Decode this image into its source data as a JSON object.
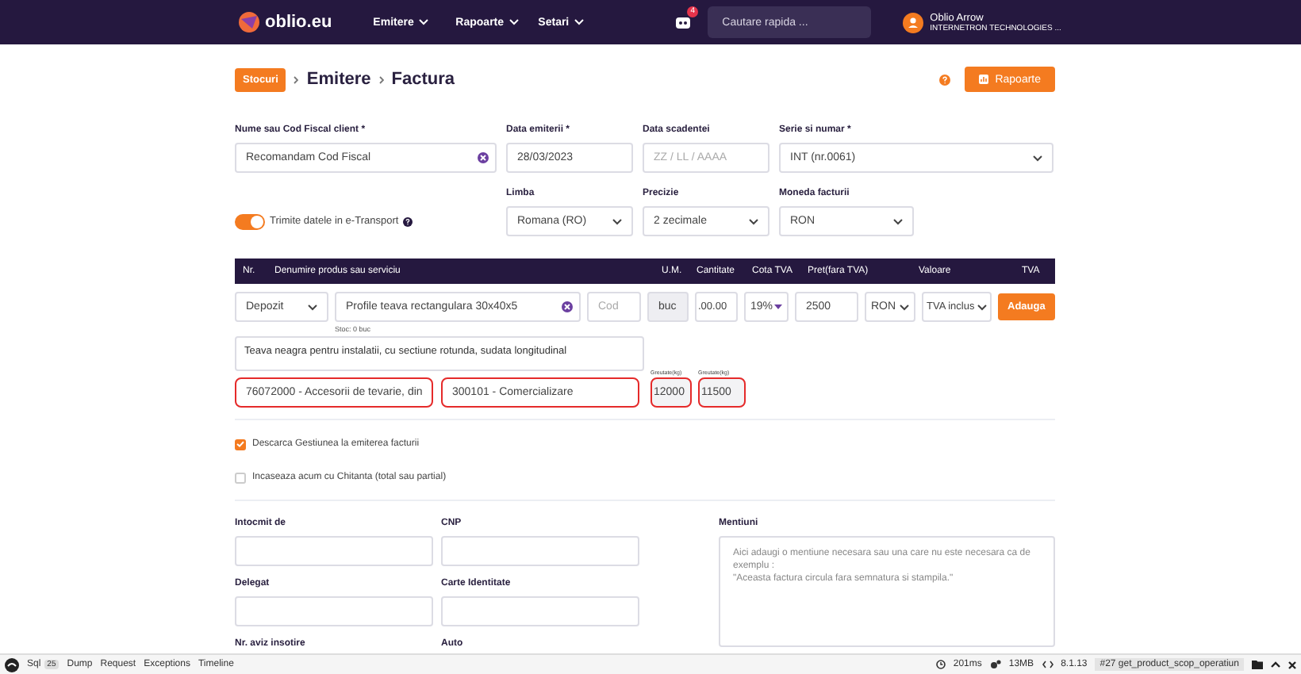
{
  "topbar": {
    "logo": "oblio.eu",
    "menu": [
      {
        "label": "Emitere"
      },
      {
        "label": "Rapoarte"
      },
      {
        "label": "Setari"
      }
    ],
    "notification_count": "4",
    "search": {
      "placeholder": "Cautare rapida ..."
    },
    "user": {
      "name": "Oblio Arrow",
      "company": "INTERNETRON TECHNOLOGIES ..."
    }
  },
  "breadcrumb": {
    "badge": "Stocuri",
    "items": [
      "Emitere",
      "Factura"
    ],
    "reports_button": "Rapoarte"
  },
  "header_fields": [
    {
      "label": "Nume sau Cod Fiscal client *",
      "kind": "clearable",
      "value": "Recomandam Cod Fiscal"
    },
    {
      "label": "Data emiterii *",
      "kind": "text",
      "value": "28/03/2023"
    },
    {
      "label": "Data scadentei",
      "kind": "text",
      "placeholder": "ZZ / LL / AAAA"
    },
    {
      "label": "Serie si numar *",
      "kind": "select",
      "value": "INT (nr.0061)"
    }
  ],
  "etransport": {
    "label": "Trimite datele in e-Transport",
    "on": true
  },
  "settings_fields": [
    {
      "label": "Limba",
      "kind": "select",
      "value": "Romana (RO)"
    },
    {
      "label": "Precizie",
      "kind": "select",
      "value": "2 zecimale"
    },
    {
      "label": "Moneda facturii",
      "kind": "select",
      "value": "RON"
    }
  ],
  "table": {
    "columns": [
      "Nr.",
      "Denumire produs sau serviciu",
      "U.M.",
      "Cantitate",
      "Cota TVA",
      "Pret(fara TVA)",
      "Valoare",
      "TVA"
    ]
  },
  "item_row": {
    "warehouse": "Depozit",
    "product_value": "Profile teava rectangulara 30x40x5",
    "code": {
      "placeholder": "Cod"
    },
    "unit": "buc",
    "quantity": ".00.00",
    "vat_rate": "19%",
    "price": "2500",
    "currency": "RON",
    "vat_mode": "TVA inclus",
    "add_button": "Adauga",
    "stock": "Stoc: 0 buc",
    "description": "Teava neagra pentru instalatii, cu sectiune rotunda, sudata longitudinal",
    "codes": [
      {
        "value": "76072000 - Accesorii de tevarie, din",
        "highlighted": true
      },
      {
        "value": "300101 - Comercializare",
        "highlighted": true
      }
    ],
    "weights": [
      {
        "label": "Greutate(kg)",
        "value": "12000",
        "highlighted": true
      },
      {
        "label": "Greutate(kg)",
        "value": "11500",
        "highlighted": true
      }
    ]
  },
  "options": [
    {
      "label": "Descarca Gestiunea la emiterea facturii",
      "checked": true
    },
    {
      "label": "Incaseaza acum cu Chitanta (total sau partial)",
      "checked": false
    }
  ],
  "extra_fields": [
    {
      "label": "Intocmit de"
    },
    {
      "label": "CNP"
    },
    {
      "label": "Delegat"
    },
    {
      "label": "Carte Identitate"
    },
    {
      "label": "Nr. aviz insotire"
    },
    {
      "label": "Auto"
    }
  ],
  "mentions": {
    "label": "Mentiuni",
    "placeholder": "Aici adaugi o mentiune necesara sau una care nu este necesara ca de exemplu :\n\"Aceasta factura circula fara semnatura si stampila.\""
  },
  "debug_bar": {
    "tabs": [
      {
        "label": "Sql",
        "count": "25"
      },
      {
        "label": "Dump"
      },
      {
        "label": "Request"
      },
      {
        "label": "Exceptions"
      },
      {
        "label": "Timeline"
      }
    ],
    "time": "201ms",
    "memory": "13MB",
    "version": "8.1.13",
    "request": "#27 get_product_scop_operatiun"
  }
}
